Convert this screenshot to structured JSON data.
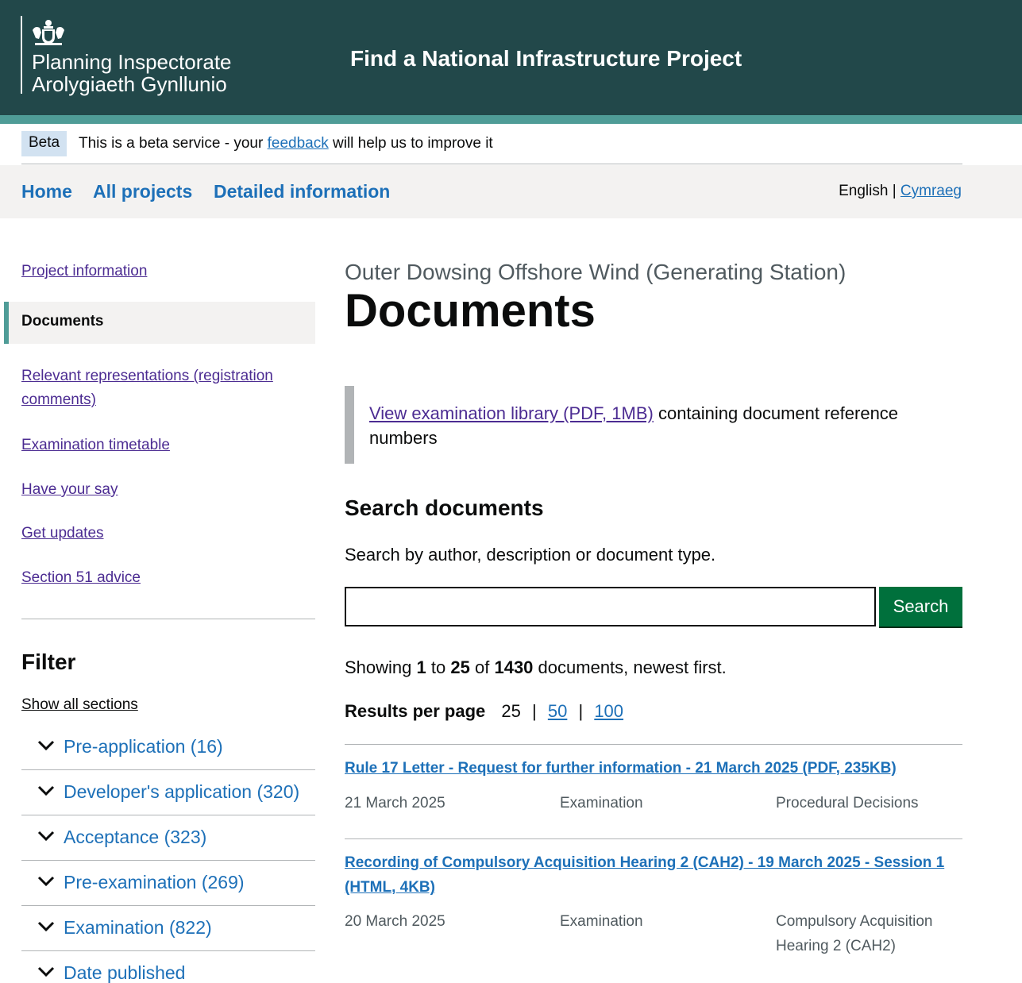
{
  "header": {
    "org_line1": "Planning Inspectorate",
    "org_line2": "Arolygiaeth Gynllunio",
    "service_title": "Find a National Infrastructure Project"
  },
  "beta": {
    "tag": "Beta",
    "text_before": "This is a beta service - your",
    "link": "feedback",
    "text_after": "will help us to improve it"
  },
  "nav": {
    "items": [
      "Home",
      "All projects",
      "Detailed information"
    ],
    "lang_current": "English",
    "lang_sep": "|",
    "lang_other": "Cymraeg"
  },
  "sidebar": {
    "items": [
      {
        "label": "Project information"
      },
      {
        "label": "Documents"
      },
      {
        "label": "Relevant representations (registration comments)"
      },
      {
        "label": "Examination timetable"
      },
      {
        "label": "Have your say"
      },
      {
        "label": "Get updates"
      },
      {
        "label": "Section 51 advice"
      }
    ]
  },
  "filter": {
    "title": "Filter",
    "show_all": "Show all sections",
    "sections": [
      {
        "label": "Pre-application (16)"
      },
      {
        "label": "Developer's application (320)"
      },
      {
        "label": "Acceptance (323)"
      },
      {
        "label": "Pre-examination (269)"
      },
      {
        "label": "Examination (822)"
      },
      {
        "label": "Date published"
      }
    ]
  },
  "main": {
    "caption": "Outer Dowsing Offshore Wind (Generating Station)",
    "title": "Documents",
    "inset_link": "View examination library (PDF, 1MB)",
    "inset_text": "containing document reference numbers",
    "search_heading": "Search documents",
    "search_hint": "Search by author, description or document type.",
    "search_value": "",
    "search_button": "Search",
    "showing": {
      "pre": "Showing",
      "from": "1",
      "to_word": "to",
      "to": "25",
      "of_word": "of",
      "total": "1430",
      "post": "documents, newest first."
    },
    "results_per_page": {
      "label": "Results per page",
      "current": "25",
      "option2": "50",
      "option3": "100",
      "sep": "|"
    }
  },
  "results": [
    {
      "title": "Rule 17 Letter - Request for further information - 21 March 2025   (PDF, 235KB)",
      "date": "21 March 2025",
      "stage": "Examination",
      "type": "Procedural Decisions"
    },
    {
      "title": "Recording of Compulsory Acquisition Hearing 2 (CAH2) - 19 March 2025 - Session 1  (HTML, 4KB)",
      "date": "20 March 2025",
      "stage": "Examination",
      "type": "Compulsory Acquisition Hearing 2 (CAH2)"
    }
  ],
  "colors": {
    "header_bg": "#22484a",
    "header_stripe": "#4f9c97",
    "link": "#1d70b8",
    "visited_link": "#4c2c92",
    "button": "#00703c"
  }
}
